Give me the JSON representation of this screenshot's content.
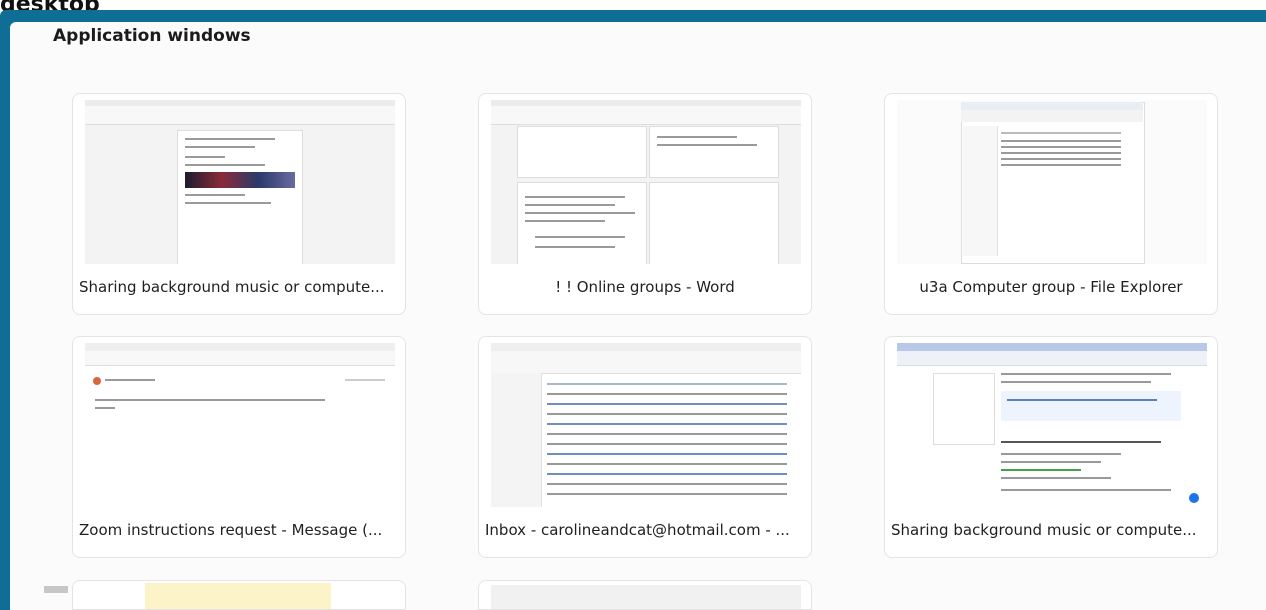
{
  "header": {
    "top_label": "desktop"
  },
  "section": {
    "title": "Application windows"
  },
  "windows": [
    {
      "title": "Sharing background music or compute..."
    },
    {
      "title": "! ! Online groups - Word"
    },
    {
      "title": "u3a Computer group - File Explorer"
    },
    {
      "title": "Zoom instructions request - Message (..."
    },
    {
      "title": "Inbox - carolineandcat@hotmail.com - ..."
    },
    {
      "title": "Sharing background music or compute..."
    }
  ],
  "colors": {
    "panel_border": "#0e6e96",
    "card_bg": "#ffffff",
    "accent_blue": "#1a73e8"
  }
}
